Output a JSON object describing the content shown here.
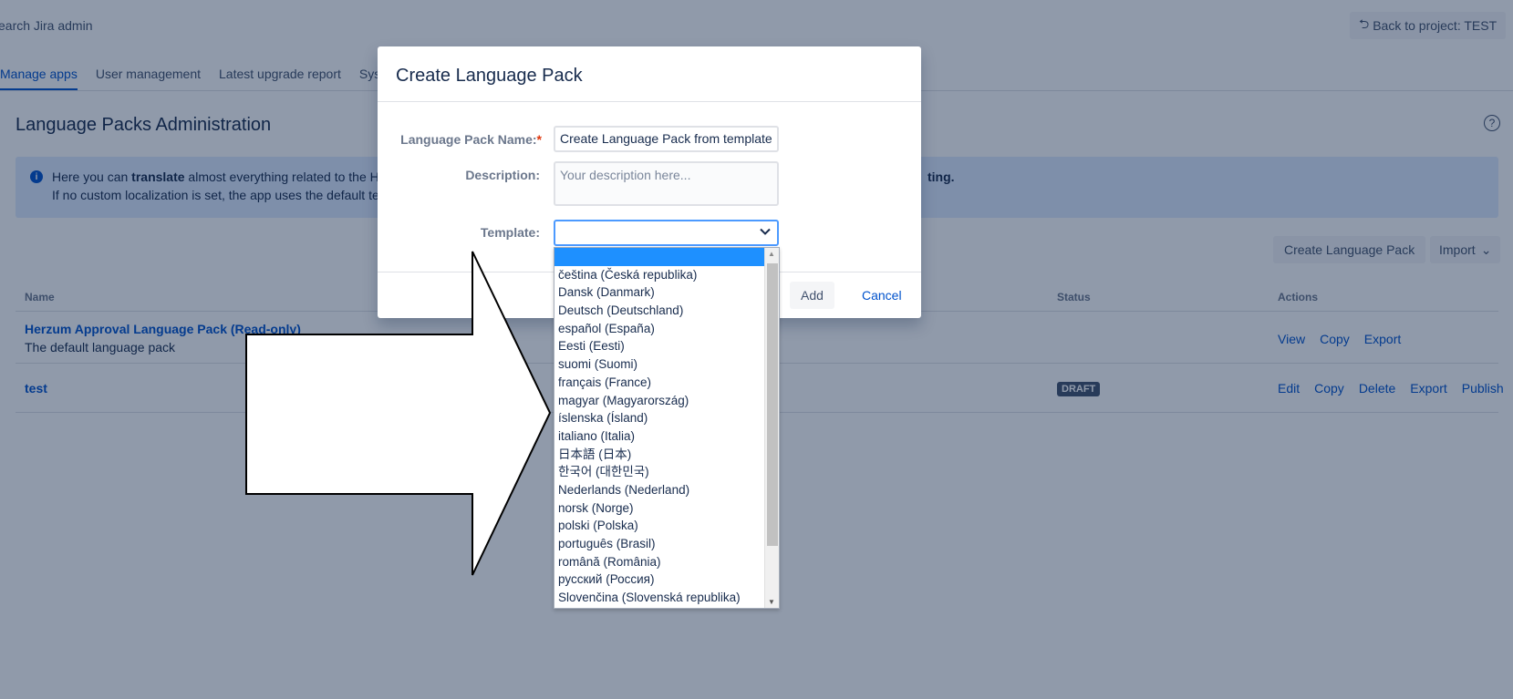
{
  "header": {
    "search_text": "earch Jira admin",
    "back_button": "Back to project: TEST"
  },
  "nav": {
    "tabs": [
      "Manage apps",
      "User management",
      "Latest upgrade report",
      "Syst"
    ]
  },
  "page": {
    "title": "Language Packs Administration",
    "help_icon": "question-circle-icon"
  },
  "info": {
    "line1_pre": "Here you can ",
    "line1_bold": "translate",
    "line1_post": " almost everything related to the H",
    "line1_end": "ting.",
    "line2": "If no custom localization is set, the app uses the default te"
  },
  "toolbar": {
    "create_label": "Create Language Pack",
    "import_label": "Import"
  },
  "table": {
    "headers": {
      "name": "Name",
      "status": "Status",
      "actions": "Actions"
    },
    "rows": [
      {
        "name": "Herzum Approval Language Pack (Read-only)",
        "description": "The default language pack",
        "status": "",
        "actions": [
          "View",
          "Copy",
          "Export"
        ]
      },
      {
        "name": "test",
        "description": "",
        "status": "DRAFT",
        "actions": [
          "Edit",
          "Copy",
          "Delete",
          "Export",
          "Publish"
        ]
      }
    ]
  },
  "dialog": {
    "title": "Create Language Pack",
    "name_label": "Language Pack Name:",
    "name_value": "Create Language Pack from template",
    "description_label": "Description:",
    "description_placeholder": "Your description here...",
    "template_label": "Template:",
    "template_value": "",
    "add_label": "Add",
    "cancel_label": "Cancel"
  },
  "dropdown": {
    "options": [
      "",
      "čeština (Česká republika)",
      "Dansk (Danmark)",
      "Deutsch (Deutschland)",
      "español (España)",
      "Eesti (Eesti)",
      "suomi (Suomi)",
      "français (France)",
      "magyar (Magyarország)",
      "íslenska (Ísland)",
      "italiano (Italia)",
      "日本語 (日本)",
      "한국어 (대한민국)",
      "Nederlands (Nederland)",
      "norsk (Norge)",
      "polski (Polska)",
      "português (Brasil)",
      "română (România)",
      "русский (Россия)",
      "Slovenčina (Slovenská republika)"
    ]
  },
  "colors": {
    "accent": "#0052cc",
    "selected_option": "#1e90ff",
    "overlay": "#091e42"
  }
}
